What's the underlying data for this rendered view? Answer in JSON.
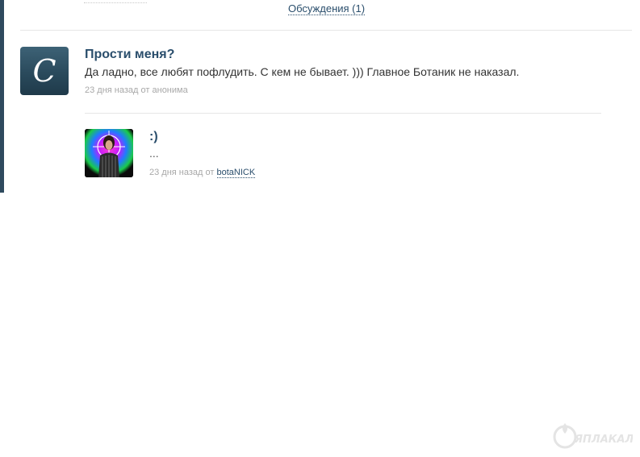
{
  "discussions_link": "Обсуждения (1)",
  "comment": {
    "title": "Прости меня?",
    "text": "Да ладно, все любят пофлудить. С кем не бывает. ))) Главное Ботаник не наказал.",
    "time": "23 дня назад",
    "from": "от",
    "author": "анонима",
    "avatar_letter": "C"
  },
  "reply": {
    "title": ":)",
    "text": "...",
    "time": "23 дня назад",
    "from": "от",
    "author": "botaNICK"
  },
  "watermark_text": "ЯПЛАКАЛ",
  "colors": {
    "accent": "#2a4e6c",
    "muted": "#a8a8a8",
    "sidebar": "#2f4a5e"
  }
}
